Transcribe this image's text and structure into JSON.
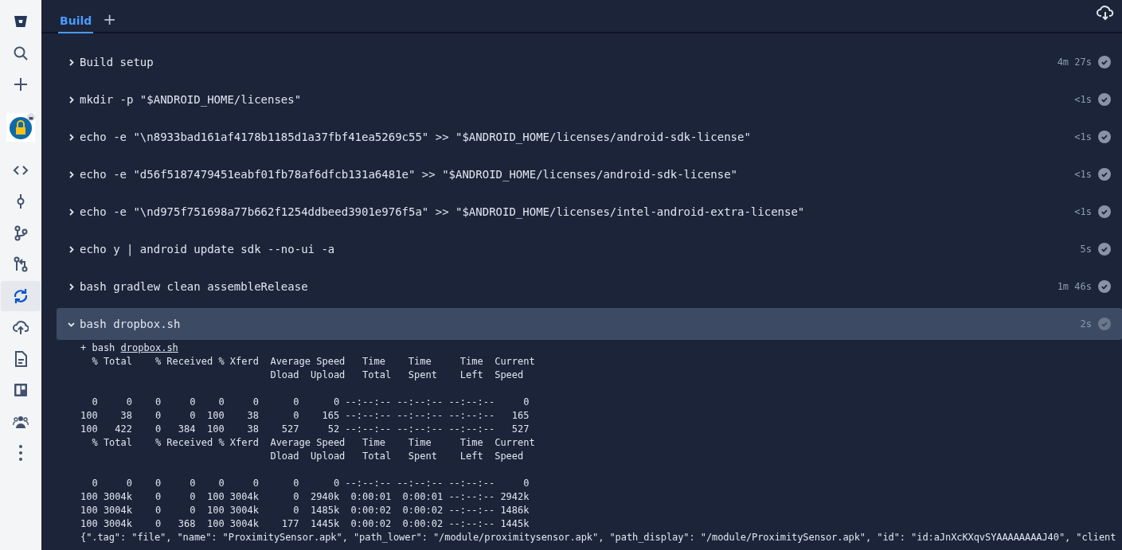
{
  "sidebar": {
    "items": [
      {
        "selected": false
      },
      {
        "selected": false
      },
      {
        "selected": false
      },
      {
        "selected": false
      },
      {
        "selected": false
      },
      {
        "selected": false
      },
      {
        "selected": false
      },
      {
        "selected": false
      },
      {
        "selected": true
      },
      {
        "selected": false
      },
      {
        "selected": false
      },
      {
        "selected": false
      },
      {
        "selected": false
      },
      {
        "selected": false
      }
    ]
  },
  "tabs": [
    {
      "label": "Build",
      "selected": true
    },
    {
      "label": "+",
      "selected": false
    }
  ],
  "steps": [
    {
      "command": "Build setup",
      "duration": "4m 27s",
      "expanded": false
    },
    {
      "command": "mkdir -p \"$ANDROID_HOME/licenses\"",
      "duration": "<1s",
      "expanded": false
    },
    {
      "command": "echo -e \"\\n8933bad161af4178b1185d1a37fbf41ea5269c55\" >> \"$ANDROID_HOME/licenses/android-sdk-license\"",
      "duration": "<1s",
      "expanded": false
    },
    {
      "command": "echo -e \"d56f5187479451eabf01fb78af6dfcb131a6481e\" >> \"$ANDROID_HOME/licenses/android-sdk-license\"",
      "duration": "<1s",
      "expanded": false
    },
    {
      "command": "echo -e \"\\nd975f751698a77b662f1254ddbeed3901e976f5a\" >> \"$ANDROID_HOME/licenses/intel-android-extra-license\"",
      "duration": "<1s",
      "expanded": false
    },
    {
      "command": "echo y | android update sdk --no-ui -a",
      "duration": "5s",
      "expanded": false
    },
    {
      "command": "bash gradlew clean assembleRelease",
      "duration": "1m 46s",
      "expanded": false
    },
    {
      "command": "bash dropbox.sh",
      "duration": "2s",
      "expanded": true
    }
  ],
  "log": {
    "command": {
      "prefix": "+ bash",
      "link": "dropbox.sh"
    },
    "tables": [
      {
        "header": [
          "  % Total    % Received % Xferd  Average Speed   Time    Time     Time  Current",
          "                                 Dload  Upload   Total   Spent    Left  Speed"
        ],
        "rows": [
          "  0     0    0     0    0     0      0      0 --:--:-- --:--:-- --:--:--     0",
          "100    38    0     0  100    38      0    165 --:--:-- --:--:-- --:--:--   165",
          "100   422    0   384  100    38    527     52 --:--:-- --:--:-- --:--:--   527"
        ]
      },
      {
        "header": [
          "  % Total    % Received % Xferd  Average Speed   Time    Time     Time  Current",
          "                                 Dload  Upload   Total   Spent    Left  Speed"
        ],
        "rows": [
          "  0     0    0     0    0     0      0      0 --:--:-- --:--:-- --:--:--     0",
          "100 3004k    0     0  100 3004k      0  2940k  0:00:01  0:00:01 --:--:-- 2942k",
          "100 3004k    0     0  100 3004k      0  1485k  0:00:02  0:00:02 --:--:-- 1486k",
          "100 3004k    0   368  100 3004k    177  1445k  0:00:02  0:00:02 --:--:-- 1445k"
        ]
      }
    ],
    "output": "{\".tag\": \"file\", \"name\": \"ProximitySensor.apk\", \"path_lower\": \"/module/proximitysensor.apk\", \"path_display\": \"/module/ProximitySensor.apk\", \"id\": \"id:aJnXcKXqvSYAAAAAAAAJ40\", \"client"
  }
}
